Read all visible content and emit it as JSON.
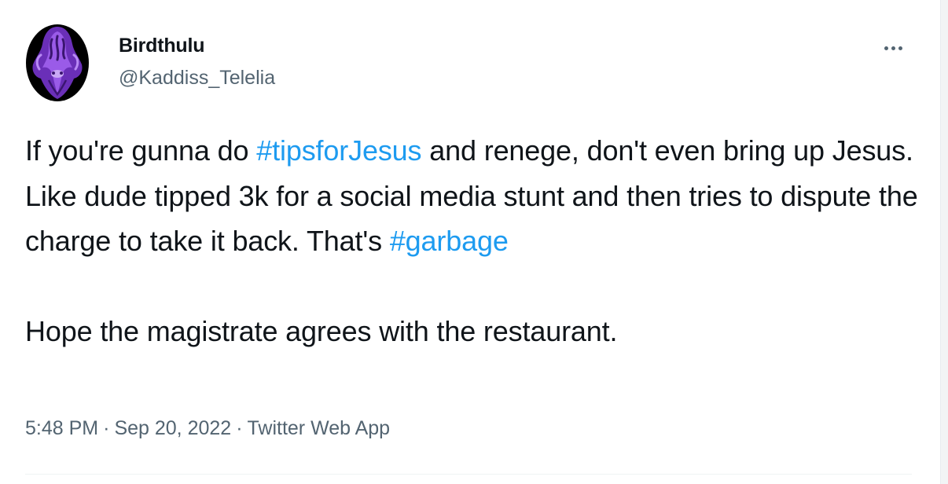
{
  "user": {
    "display_name": "Birdthulu",
    "handle": "@Kaddiss_Telelia",
    "avatar_icon": "purple-tentacled-creature-avatar"
  },
  "more_icon": "ellipsis-icon",
  "tweet": {
    "line1_pre": "If you're gunna do ",
    "hashtag1": "#tipsforJesus",
    "line1_post": " and renege, don't even bring up Jesus. Like dude tipped 3k for a social media stunt and then tries to dispute the charge to take it back. That's ",
    "hashtag2": "#garbage",
    "paragraph2": "Hope the magistrate agrees with the restaurant."
  },
  "meta": {
    "time": "5:48 PM",
    "separator": "·",
    "date": "Sep 20, 2022",
    "source": "Twitter Web App"
  },
  "colors": {
    "link": "#1d9bf0",
    "secondary_text": "#536471",
    "primary_text": "#0f1419",
    "avatar_purple": "#7b3fc4"
  }
}
